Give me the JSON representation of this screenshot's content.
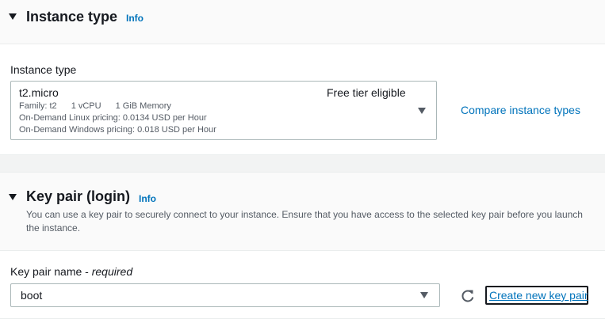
{
  "instance_section": {
    "title": "Instance type",
    "info": "Info",
    "field_label": "Instance type",
    "selected": {
      "name": "t2.micro",
      "tier": "Free tier eligible",
      "family": "Family: t2",
      "vcpu": "1 vCPU",
      "memory": "1 GiB Memory",
      "linux_pricing": "On-Demand Linux pricing: 0.0134 USD per Hour",
      "windows_pricing": "On-Demand Windows pricing: 0.018 USD per Hour"
    },
    "compare_link": "Compare instance types"
  },
  "keypair_section": {
    "title": "Key pair (login)",
    "info": "Info",
    "description": "You can use a key pair to securely connect to your instance. Ensure that you have access to the selected key pair before you launch the instance.",
    "field_label": "Key pair name",
    "field_required": "required",
    "selected": "boot",
    "create_link": "Create new key pair"
  },
  "icons": {
    "collapse": "caret-down-icon",
    "dropdown": "dropdown-arrow-icon",
    "refresh": "refresh-icon"
  },
  "colors": {
    "link": "#0073bb",
    "text": "#16191f",
    "muted": "#545b64",
    "border": "#aab7b8"
  }
}
